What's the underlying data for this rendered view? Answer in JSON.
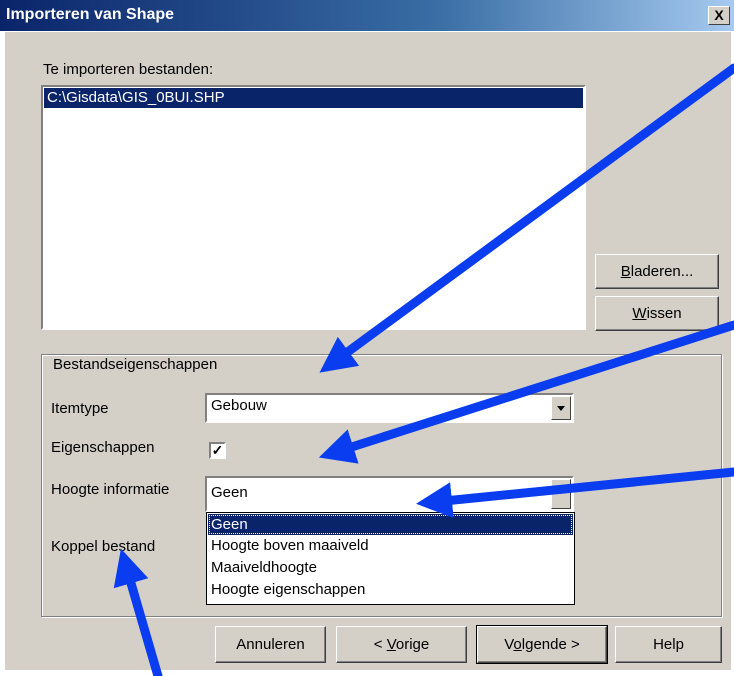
{
  "window": {
    "title": "Importeren van Shape",
    "close_label": "X"
  },
  "files": {
    "label": "Te importeren bestanden:",
    "items": [
      "C:\\Gisdata\\GIS_0BUI.SHP"
    ]
  },
  "buttons": {
    "browse_pre": "B",
    "browse_rest": "laderen...",
    "clear_pre": "W",
    "clear_rest": "issen",
    "cancel": "Annuleren",
    "prev_pre": "< ",
    "prev_u": "V",
    "prev_rest": "orige",
    "next_pre": "V",
    "next_u": "o",
    "next_rest": "lgende >",
    "help": "Help"
  },
  "properties": {
    "group_title": "Bestandseigenschappen",
    "itemtype_label": "Itemtype",
    "itemtype_value": "Gebouw",
    "eigenschappen_label": "Eigenschappen",
    "eigenschappen_checked": "✓",
    "height_label": "Hoogte informatie",
    "height_value": "Geen",
    "link_label": "Koppel bestand"
  },
  "height_options": [
    "Geen",
    "Hoogte boven maaiveld",
    "Maaiveldhoogte",
    "Hoogte eigenschappen"
  ],
  "annotation_color": "#0a3cf0"
}
